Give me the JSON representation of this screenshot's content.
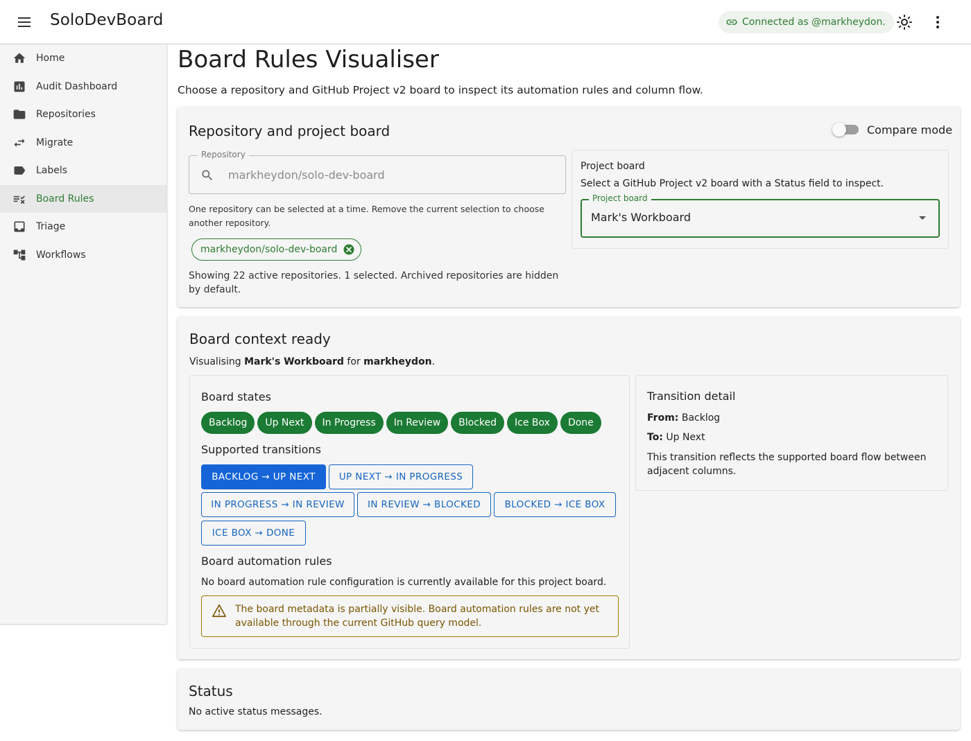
{
  "header": {
    "app_title": "SoloDevBoard",
    "connection": "Connected as @markheydon.",
    "icons": [
      "menu-icon",
      "link-icon",
      "sun-icon",
      "more-vert-icon"
    ]
  },
  "sidebar": {
    "items": [
      {
        "label": "Home",
        "icon": "home-icon"
      },
      {
        "label": "Audit Dashboard",
        "icon": "chart-icon"
      },
      {
        "label": "Repositories",
        "icon": "folder-icon"
      },
      {
        "label": "Migrate",
        "icon": "swap-icon"
      },
      {
        "label": "Labels",
        "icon": "label-icon"
      },
      {
        "label": "Board Rules",
        "icon": "rule-icon"
      },
      {
        "label": "Triage",
        "icon": "inbox-icon"
      },
      {
        "label": "Workflows",
        "icon": "workflow-icon"
      }
    ],
    "active": "Board Rules"
  },
  "page": {
    "title": "Board Rules Visualiser",
    "subtitle": "Choose a repository and GitHub Project v2 board to inspect its automation rules and column flow."
  },
  "selection_card": {
    "title": "Repository and project board",
    "compare_mode_label": "Compare mode",
    "compare_mode_on": false,
    "repository": {
      "label": "Repository",
      "placeholder": "markheydon/solo-dev-board",
      "helper": "One repository can be selected at a time. Remove the current selection to choose another repository.",
      "selected_chip": "markheydon/solo-dev-board",
      "showing": "Showing 22 active repositories. 1 selected. Archived repositories are hidden by default."
    },
    "project_board": {
      "title": "Project board",
      "description": "Select a GitHub Project v2 board with a Status field to inspect.",
      "label": "Project board",
      "value": "Mark's Workboard"
    }
  },
  "context_card": {
    "title": "Board context ready",
    "desc_prefix": "Visualising ",
    "board_name": "Mark's Workboard",
    "desc_middle": " for ",
    "owner": "markheydon",
    "desc_suffix": ".",
    "states_title": "Board states",
    "states": [
      "Backlog",
      "Up Next",
      "In Progress",
      "In Review",
      "Blocked",
      "Ice Box",
      "Done"
    ],
    "transitions_title": "Supported transitions",
    "transitions": [
      "BACKLOG → UP NEXT",
      "UP NEXT → IN PROGRESS",
      "IN PROGRESS → IN REVIEW",
      "IN REVIEW → BLOCKED",
      "BLOCKED → ICE BOX",
      "ICE BOX → DONE"
    ],
    "selected_transition": 0,
    "rules_title": "Board automation rules",
    "rules_desc": "No board automation rule configuration is currently available for this project board.",
    "warning": "The board metadata is partially visible. Board automation rules are not yet available through the current GitHub query model.",
    "detail": {
      "title": "Transition detail",
      "from_label": "From:",
      "from": "Backlog",
      "to_label": "To:",
      "to": "Up Next",
      "desc": "This transition reflects the supported board flow between adjacent columns."
    }
  },
  "status_card": {
    "title": "Status",
    "message": "No active status messages."
  },
  "colors": {
    "accent_green": "#2e7d32",
    "state_chip": "#1b7a34",
    "primary_blue": "#1565c0",
    "warning": "#a07800"
  }
}
